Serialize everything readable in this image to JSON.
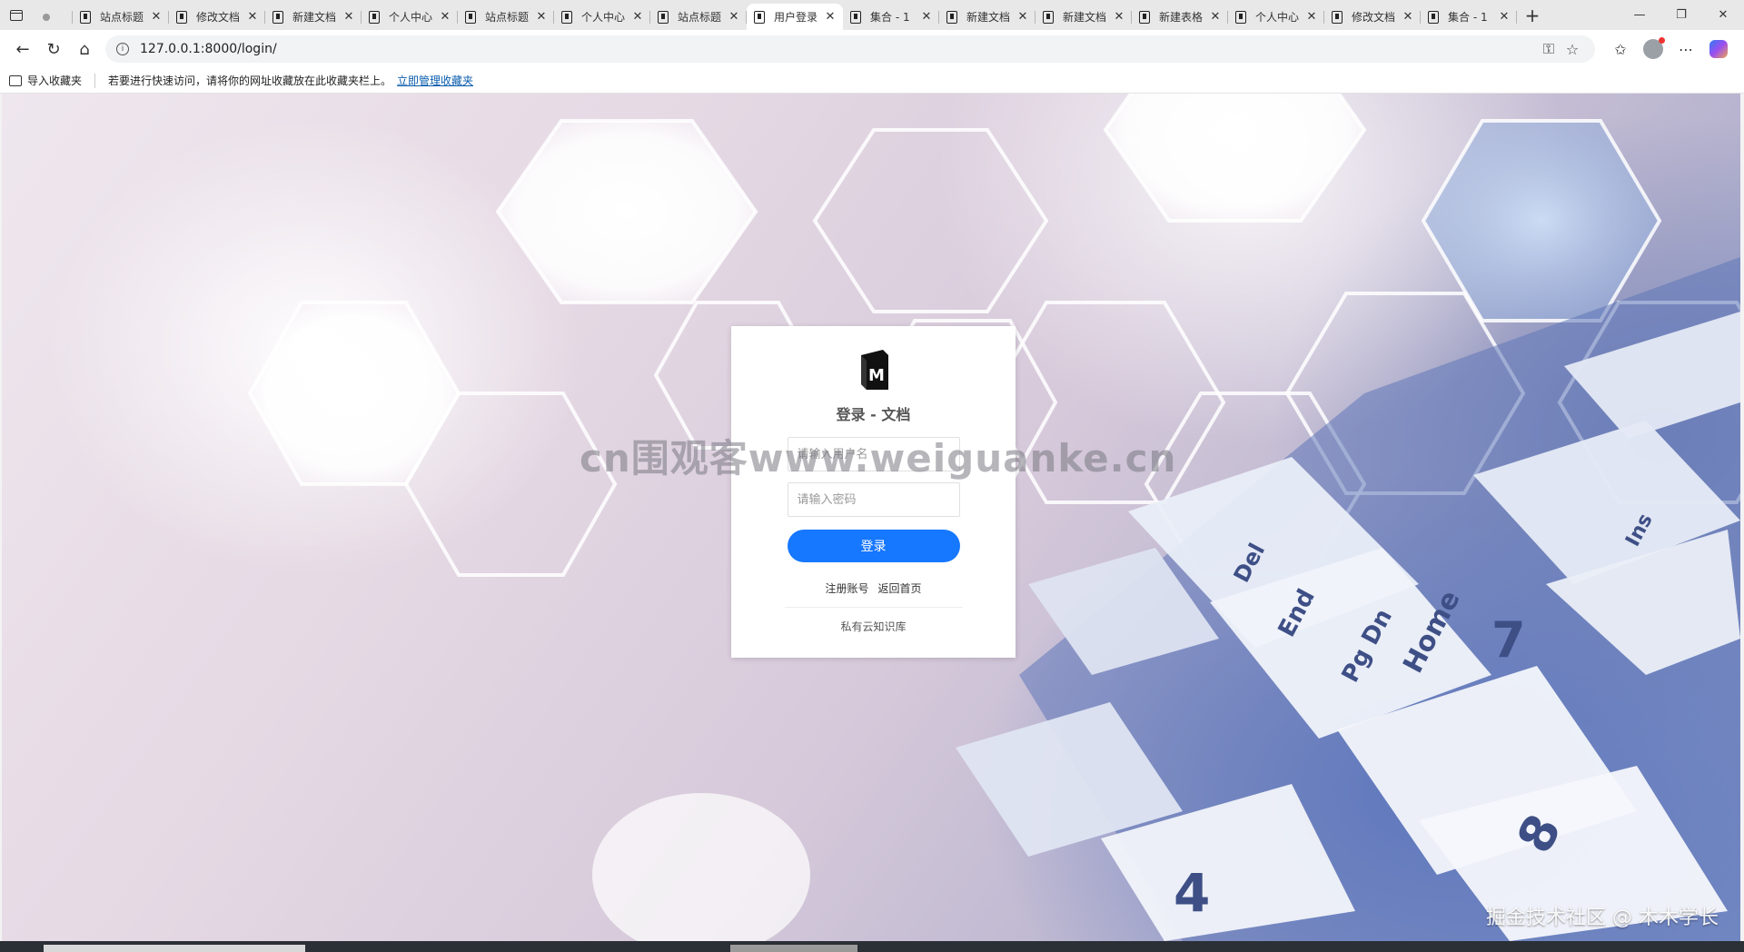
{
  "browser": {
    "tabs": [
      {
        "title": "",
        "pinned": true,
        "active": false
      },
      {
        "title": "站点标题",
        "active": false
      },
      {
        "title": "修改文档",
        "active": false
      },
      {
        "title": "新建文档",
        "active": false
      },
      {
        "title": "个人中心",
        "active": false
      },
      {
        "title": "站点标题",
        "active": false
      },
      {
        "title": "个人中心",
        "active": false
      },
      {
        "title": "站点标题",
        "active": false
      },
      {
        "title": "用户登录",
        "active": true
      },
      {
        "title": "集合 - 1",
        "active": false
      },
      {
        "title": "新建文档",
        "active": false
      },
      {
        "title": "新建文档",
        "active": false
      },
      {
        "title": "新建表格",
        "active": false
      },
      {
        "title": "个人中心",
        "active": false
      },
      {
        "title": "修改文档",
        "active": false
      },
      {
        "title": "集合 - 1",
        "active": false
      }
    ],
    "close_glyph": "✕",
    "new_tab_glyph": "+",
    "window_controls": {
      "minimize": "—",
      "restore": "❐",
      "close": "✕"
    },
    "address": {
      "url": "127.0.0.1:8000/login/"
    },
    "favorites_bar": {
      "import_label": "导入收藏夹",
      "hint": "若要进行快速访问，请将你的网址收藏放在此收藏夹栏上。",
      "manage_link": "立即管理收藏夹"
    }
  },
  "login": {
    "logo_letter": "M",
    "title": "登录 - 文档",
    "username_placeholder": "请输入用户名",
    "password_placeholder": "请输入密码",
    "submit_label": "登录",
    "register_link": "注册账号",
    "home_link": "返回首页",
    "footer": "私有云知识库"
  },
  "overlays": {
    "watermark": "cn围观客www.weiguanke.cn",
    "credit": "掘金技术社区 @ 木木学长"
  },
  "colors": {
    "accent": "#1677ff",
    "tabstrip": "#e8e8e8",
    "link": "#0b5cad"
  }
}
